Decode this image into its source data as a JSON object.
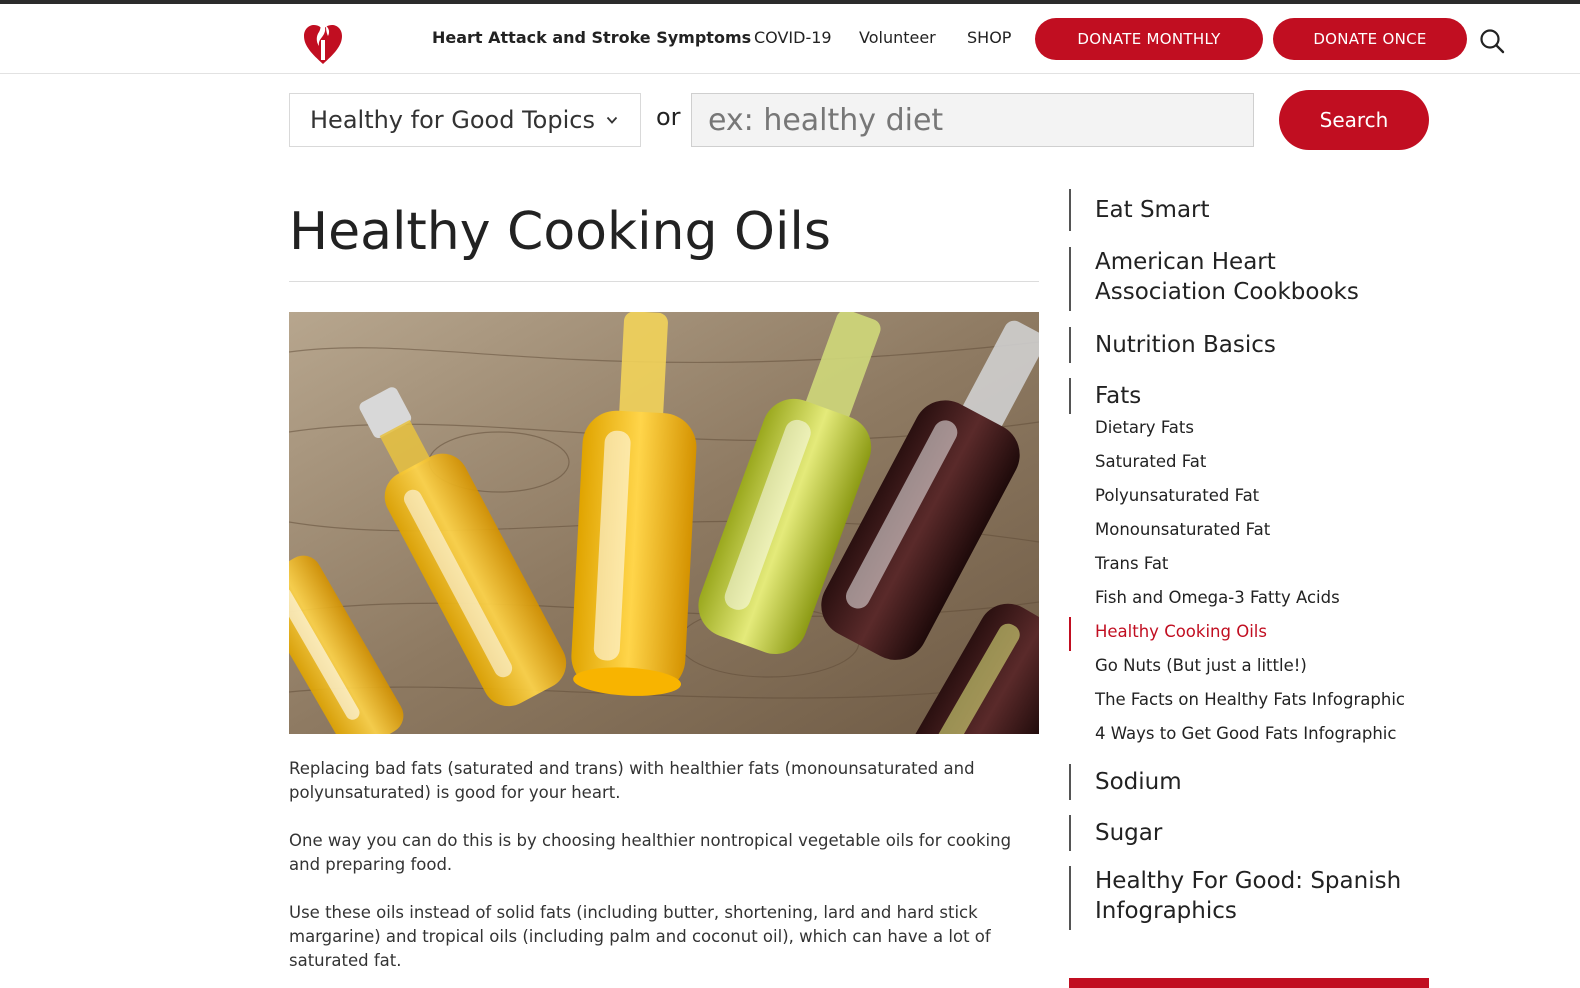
{
  "header": {
    "nav": [
      {
        "label": "Heart Attack and Stroke Symptoms"
      },
      {
        "label": "COVID-19"
      },
      {
        "label": "Volunteer"
      },
      {
        "label": "SHOP"
      }
    ],
    "donate_monthly": "DONATE MONTHLY",
    "donate_once": "DONATE ONCE",
    "icons": {
      "logo": "heart-torch-logo",
      "search": "search-icon"
    },
    "brand_color": "#c10e21"
  },
  "search_bar": {
    "topic_select": "Healthy for Good Topics",
    "or_label": "or",
    "placeholder": "ex: healthy diet",
    "value": "",
    "button": "Search"
  },
  "article": {
    "title": "Healthy Cooking Oils",
    "paragraphs": [
      "Replacing bad fats (saturated and trans) with healthier fats (monounsaturated and polyunsaturated) is good for your heart.",
      "One way you can do this is by choosing healthier nontropical vegetable oils for cooking and preparing food.",
      "Use these oils instead of solid fats (including butter, shortening, lard and hard stick margarine) and tropical oils (including palm and coconut oil), which can have a lot of saturated fat."
    ]
  },
  "sidebar": {
    "sections": [
      {
        "label": "Eat Smart"
      },
      {
        "label": "American Heart Association Cookbooks"
      },
      {
        "label": "Nutrition Basics"
      },
      {
        "label": "Fats"
      },
      {
        "label": "Sodium"
      },
      {
        "label": "Sugar"
      },
      {
        "label": "Healthy For Good: Spanish Infographics"
      }
    ],
    "fats_items": [
      {
        "label": "Dietary Fats"
      },
      {
        "label": "Saturated Fat"
      },
      {
        "label": "Polyunsaturated Fat"
      },
      {
        "label": "Monounsaturated Fat"
      },
      {
        "label": "Trans Fat"
      },
      {
        "label": "Fish and Omega-3 Fatty Acids"
      },
      {
        "label": "Healthy Cooking Oils"
      },
      {
        "label": "Go Nuts (But just a little!)"
      },
      {
        "label": "The Facts on Healthy Fats Infographic"
      },
      {
        "label": "4 Ways to Get Good Fats Infographic"
      }
    ],
    "active_item": "Healthy Cooking Oils"
  }
}
